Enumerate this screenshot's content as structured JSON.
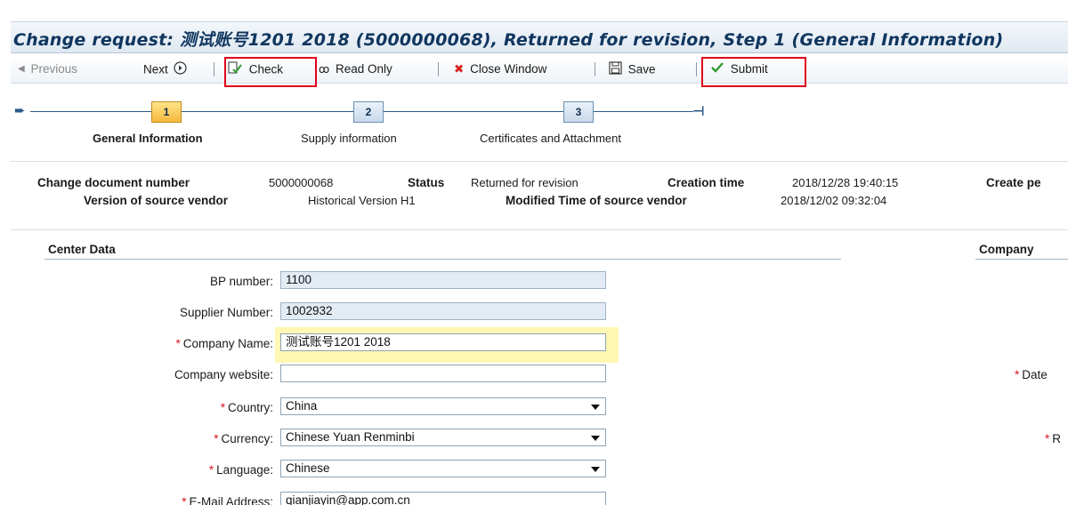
{
  "window": {
    "title": "Change request: 测试账号1201 2018 (5000000068), Returned for revision, Step 1  (General Information)"
  },
  "toolbar": {
    "previous_label": "Previous",
    "next_label": "Next",
    "check_label": "Check",
    "read_only_label": "Read Only",
    "close_window_label": "Close Window",
    "save_label": "Save",
    "submit_label": "Submit"
  },
  "roadmap": {
    "steps": [
      {
        "number": "1",
        "label": "General Information",
        "active": true
      },
      {
        "number": "2",
        "label": "Supply information",
        "active": false
      },
      {
        "number": "3",
        "label": "Certificates and Attachment",
        "active": false
      }
    ]
  },
  "header": {
    "change_document_number_label": "Change document number",
    "change_document_number": "5000000068",
    "status_label": "Status",
    "status": "Returned for revision",
    "creation_time_label": "Creation time",
    "creation_time": "2018/12/28 19:40:15",
    "create_person_label": "Create pe",
    "version_label": "Version of source vendor",
    "version": "Historical Version H1",
    "modified_time_label": "Modified Time of source vendor",
    "modified_time": "2018/12/02 09:32:04"
  },
  "center_data": {
    "section_title": "Center Data",
    "fields": {
      "bp_number": {
        "label": "BP number:",
        "value": "1100"
      },
      "supplier_number": {
        "label": "Supplier Number:",
        "value": "1002932"
      },
      "company_name": {
        "label": "Company Name:",
        "value": "测试账号1201 2018"
      },
      "company_website": {
        "label": "Company website:",
        "value": ""
      },
      "country": {
        "label": "Country:",
        "value": "China"
      },
      "currency": {
        "label": "Currency:",
        "value": "Chinese Yuan Renminbi"
      },
      "language": {
        "label": "Language:",
        "value": "Chinese"
      },
      "email": {
        "label": "E-Mail Address:",
        "value": "qianjiayin@app.com.cn"
      }
    },
    "required_marker": "*"
  },
  "company_data": {
    "section_title": "Company",
    "date_label": "Date",
    "r_label": "R"
  },
  "colors": {
    "title": "#10365f",
    "highlight_box": "#e0001a",
    "required": "#d4141f",
    "active_step": "#f6b73c",
    "submit_check": "#2e9a2e",
    "close_x": "#d81f1f"
  }
}
